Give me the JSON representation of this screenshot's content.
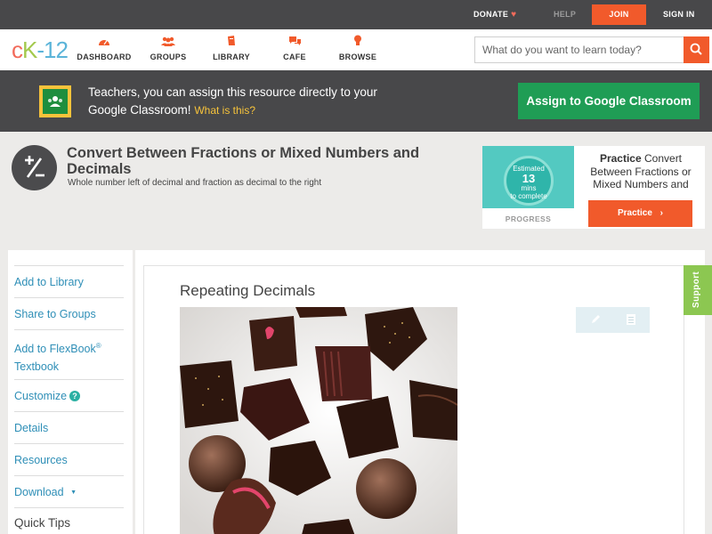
{
  "topbar": {
    "donate": "DONATE",
    "help": "HELP",
    "join": "JOIN",
    "signin": "SIGN IN"
  },
  "nav": {
    "logo_parts": [
      "c",
      "K",
      "-12"
    ],
    "items": [
      {
        "label": "DASHBOARD",
        "icon": "dashboard-icon"
      },
      {
        "label": "GROUPS",
        "icon": "groups-icon"
      },
      {
        "label": "LIBRARY",
        "icon": "library-icon"
      },
      {
        "label": "CAFE",
        "icon": "cafe-icon"
      },
      {
        "label": "BROWSE",
        "icon": "browse-icon"
      }
    ],
    "search_placeholder": "What do you want to learn today?"
  },
  "google_banner": {
    "text": "Teachers, you can assign this resource directly to your Google Classroom!",
    "what_is_this": "What is this?",
    "button": "Assign to Google Classroom"
  },
  "header": {
    "title": "Convert Between Fractions or Mixed Numbers and Decimals",
    "subtitle": "Whole number left of decimal and fraction as decimal to the right"
  },
  "practice": {
    "estimated_line1": "Estimated",
    "estimated_value": "13",
    "estimated_line2": "mins",
    "estimated_line3": "to complete",
    "progress_label": "PROGRESS",
    "text_bold": "Practice",
    "text_rest": "Convert Between Fractions or Mixed Numbers and",
    "button": "Practice"
  },
  "sidebar": {
    "items": [
      {
        "label": "Add to Library"
      },
      {
        "label": "Share to Groups"
      },
      {
        "label": "Add to FlexBook",
        "sup": "®",
        "label2": "Textbook"
      },
      {
        "label": "Customize"
      },
      {
        "label": "Details"
      },
      {
        "label": "Resources"
      },
      {
        "label": "Download",
        "caret": "▼"
      }
    ],
    "quick_tips": "Quick Tips"
  },
  "content": {
    "concept_title": "Repeating Decimals"
  },
  "support": "Support",
  "colors": {
    "accent": "#f15a2b",
    "dark": "#48484a",
    "link": "#2f8fb7",
    "google_green": "#1f9d55"
  }
}
